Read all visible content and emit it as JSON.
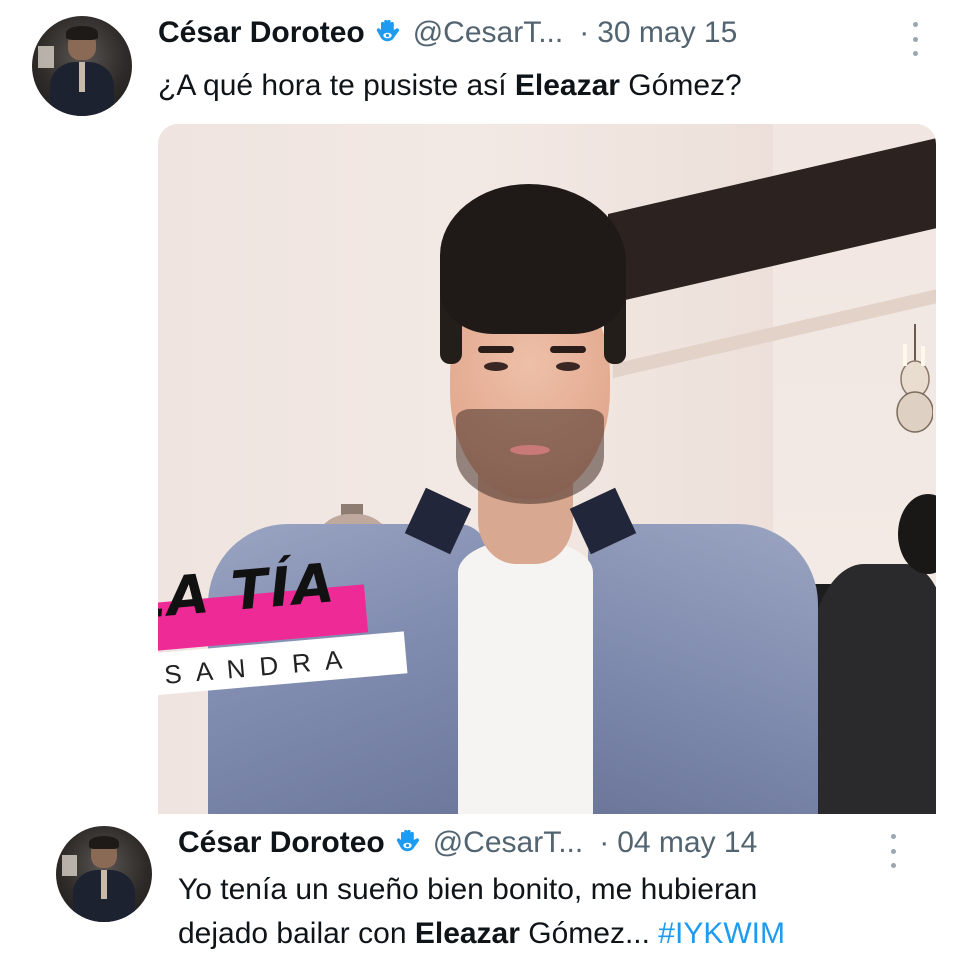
{
  "tweets": [
    {
      "author_name": "César Doroteo",
      "handle": "@CesarT...",
      "separator": "·",
      "date": "30 may 15",
      "text_parts": [
        "¿A qué hora te pusiste así ",
        "Eleazar",
        " Gómez?"
      ],
      "media": {
        "stamp_title": "LA TÍA",
        "stamp_subtitle": "SANDRA"
      }
    },
    {
      "author_name": "César Doroteo",
      "handle": "@CesarT...",
      "separator": "·",
      "date": "04 may 14",
      "text_line1": "Yo tenía un sueño bien bonito, me hubieran",
      "text_line2_parts": [
        "dejado bailar con ",
        "Eleazar",
        " Gómez... ",
        "#IYKWIM"
      ]
    }
  ],
  "colors": {
    "text_primary": "#0f1419",
    "text_secondary": "#536471",
    "link": "#1d9bf0",
    "badge": "#1d9bf0",
    "stamp_pink": "#ee2a96"
  },
  "icons": {
    "badge": "hamsa-hand-icon",
    "more": "more-options-icon"
  }
}
